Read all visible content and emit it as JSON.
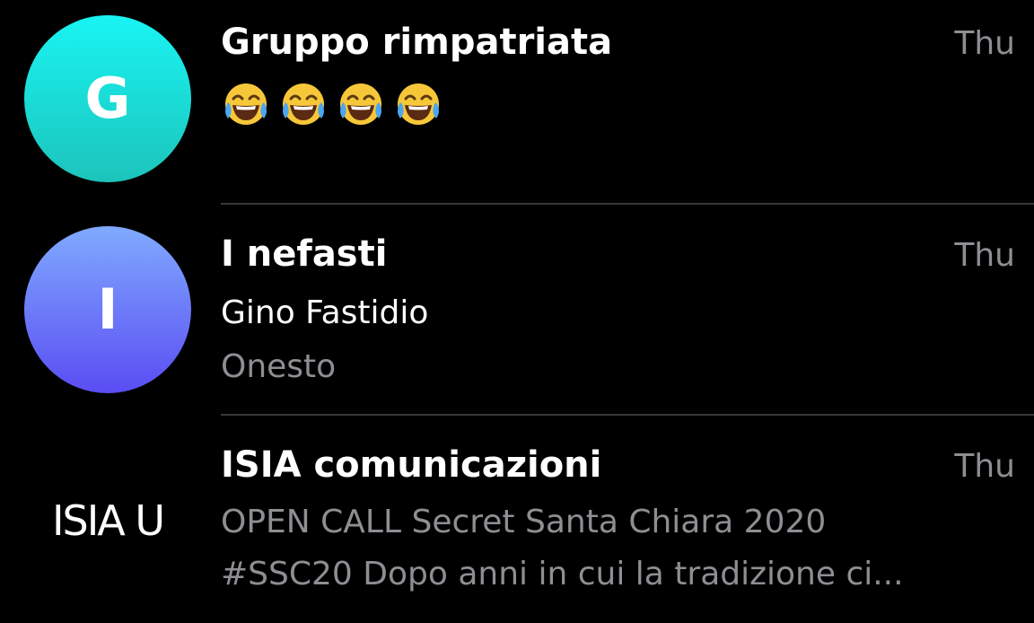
{
  "chats": [
    {
      "avatar_letter": "G",
      "title": "Gruppo rimpatriata",
      "date": "Thu",
      "preview_emojis": [
        "face-with-tears-of-joy-icon",
        "face-with-tears-of-joy-icon",
        "face-with-tears-of-joy-icon",
        "face-with-tears-of-joy-icon"
      ],
      "avatar_colors": [
        "#19f1f0",
        "#1cc6bb"
      ]
    },
    {
      "avatar_letter": "I",
      "title": "I nefasti",
      "date": "Thu",
      "sender": "Gino Fastidio",
      "preview": "Onesto",
      "avatar_colors": [
        "#7fa9ff",
        "#5a4ef2"
      ]
    },
    {
      "avatar_text": "ISIA U",
      "title": "ISIA comunicazioni",
      "date": "Thu",
      "preview_line1": "OPEN CALL Secret Santa Chiara 2020",
      "preview_line2": "#SSC20 Dopo anni in cui la tradizione ci..."
    }
  ],
  "colors": {
    "background": "#000000",
    "title": "#ffffff",
    "secondary": "#8e8e93",
    "separator": "#38383a"
  }
}
